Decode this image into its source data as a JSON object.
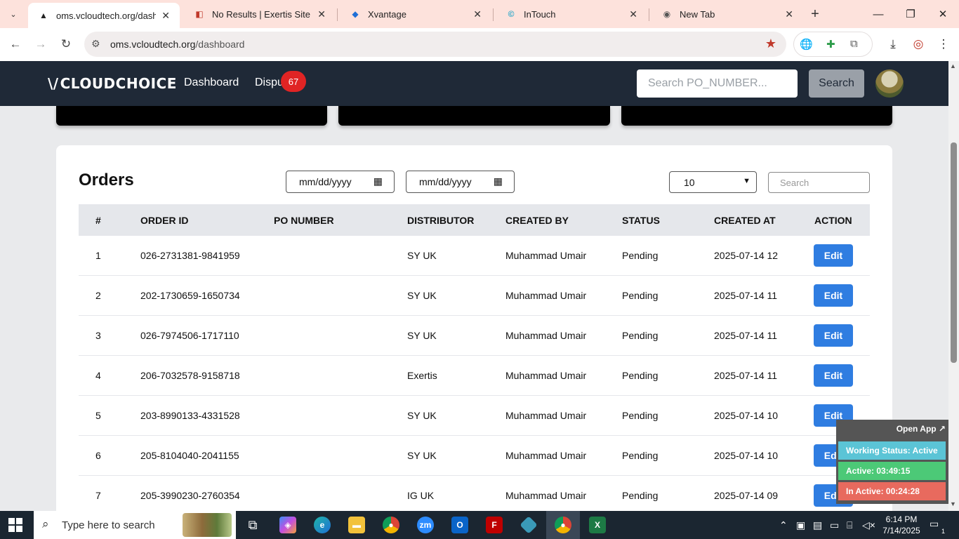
{
  "browser": {
    "tabs": [
      {
        "label": "oms.vcloudtech.org/dashbo",
        "active": true,
        "favicon": "triangle-icon"
      },
      {
        "label": "No Results | Exertis Site",
        "active": false,
        "favicon": "exertis-icon"
      },
      {
        "label": "Xvantage",
        "active": false,
        "favicon": "xvantage-icon"
      },
      {
        "label": "InTouch",
        "active": false,
        "favicon": "intouch-icon"
      },
      {
        "label": "New Tab",
        "active": false,
        "favicon": "chrome-icon"
      }
    ],
    "url_host": "oms.vcloudtech.org",
    "url_path": "/dashboard"
  },
  "app": {
    "logo": "CLOUDCHOICE",
    "nav": {
      "dashboard": "Dashboard",
      "disputes": "Dispu",
      "disputes_badge": "67"
    },
    "search_placeholder": "Search PO_NUMBER...",
    "search_button": "Search"
  },
  "orders": {
    "title": "Orders",
    "date_from_placeholder": "mm/dd/yyyy",
    "date_to_placeholder": "mm/dd/yyyy",
    "page_size": "10",
    "search_placeholder": "Search",
    "columns": [
      "#",
      "ORDER ID",
      "PO NUMBER",
      "DISTRIBUTOR",
      "CREATED BY",
      "STATUS",
      "CREATED AT",
      "ACTION"
    ],
    "edit_label": "Edit",
    "rows": [
      {
        "n": "1",
        "order_id": "026-2731381-9841959",
        "po": "",
        "distributor": "SY UK",
        "created_by": "Muhammad Umair",
        "status": "Pending",
        "created_at": "2025-07-14 12"
      },
      {
        "n": "2",
        "order_id": "202-1730659-1650734",
        "po": "",
        "distributor": "SY UK",
        "created_by": "Muhammad Umair",
        "status": "Pending",
        "created_at": "2025-07-14 11"
      },
      {
        "n": "3",
        "order_id": "026-7974506-1717110",
        "po": "",
        "distributor": "SY UK",
        "created_by": "Muhammad Umair",
        "status": "Pending",
        "created_at": "2025-07-14 11"
      },
      {
        "n": "4",
        "order_id": "206-7032578-9158718",
        "po": "",
        "distributor": "Exertis",
        "created_by": "Muhammad Umair",
        "status": "Pending",
        "created_at": "2025-07-14 11"
      },
      {
        "n": "5",
        "order_id": "203-8990133-4331528",
        "po": "",
        "distributor": "SY UK",
        "created_by": "Muhammad Umair",
        "status": "Pending",
        "created_at": "2025-07-14 10"
      },
      {
        "n": "6",
        "order_id": "205-8104040-2041155",
        "po": "",
        "distributor": "SY UK",
        "created_by": "Muhammad Umair",
        "status": "Pending",
        "created_at": "2025-07-14 10"
      },
      {
        "n": "7",
        "order_id": "205-3990230-2760354",
        "po": "",
        "distributor": "IG UK",
        "created_by": "Muhammad Umair",
        "status": "Pending",
        "created_at": "2025-07-14 09"
      }
    ]
  },
  "tracker": {
    "open_app": "Open App ↗",
    "working_status": "Working Status: Active",
    "active": "Active: 03:49:15",
    "inactive": "In Active: 00:24:28",
    "colors": {
      "status": "#5bc4d6",
      "active": "#4cc977",
      "inactive": "#e86a5e"
    }
  },
  "taskbar": {
    "search_placeholder": "Type here to search",
    "time": "6:14 PM",
    "date": "7/14/2025",
    "notifications": "1"
  },
  "colors": {
    "navbar": "#1f2937",
    "badge": "#e02424",
    "edit_button": "#2f7de1",
    "tabstrip": "#fde2dc"
  }
}
